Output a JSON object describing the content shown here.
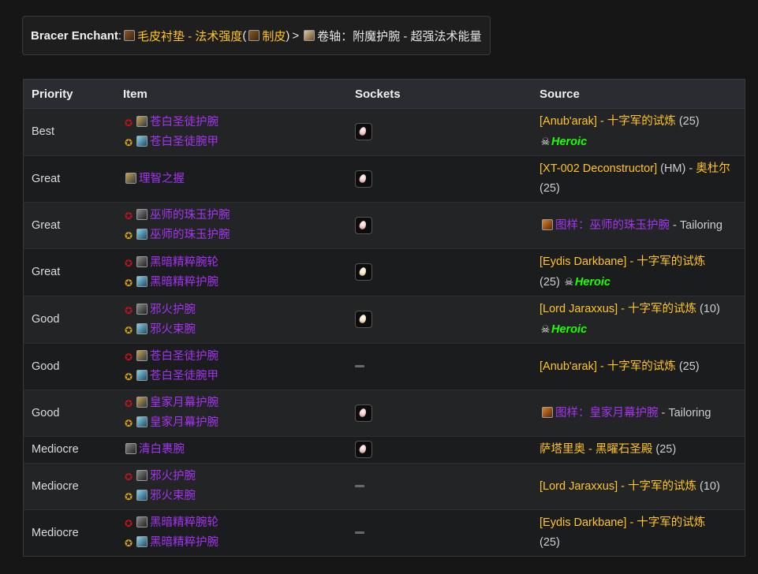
{
  "enchant": {
    "label": "Bracer Enchant",
    "colon": ":",
    "item1": "毛皮衬垫 - 法术强度",
    "paren_open": "(",
    "profession": "制皮",
    "paren_close": ")",
    "arrow": ">",
    "item2": "卷轴：附魔护腕 - 超强法术能量"
  },
  "table": {
    "headers": {
      "priority": "Priority",
      "item": "Item",
      "sockets": "Sockets",
      "source": "Source"
    },
    "rows": [
      {
        "priority": "Best",
        "horde_item": "苍白圣徒护腕",
        "alliance_item": "苍白圣徒腕甲",
        "socket": "gem",
        "src_a": "[Anub'arak] - 十字军的试炼",
        "src_b": " (25)",
        "heroic": "Heroic"
      },
      {
        "priority": "Great",
        "item": "理智之握",
        "socket": "gem",
        "src_a": "[XT-002 Deconstructor]",
        "src_b": " (HM) - ",
        "src_c": "奥杜尔",
        "src_d": " (25)"
      },
      {
        "priority": "Great",
        "horde_item": "巫师的珠玉护腕",
        "alliance_item": "巫师的珠玉护腕",
        "socket": "gem",
        "pattern": "图样：巫师的珠玉护腕",
        "pattern_suffix": " - Tailoring"
      },
      {
        "priority": "Great",
        "horde_item": "黑暗精粹腕轮",
        "alliance_item": "黑暗精粹护腕",
        "socket": "gem-yellow",
        "src_a": "[Eydis Darkbane] - 十字军的试炼",
        "src_b": " (25) ",
        "heroic": "Heroic"
      },
      {
        "priority": "Good",
        "horde_item": "邪火护腕",
        "alliance_item": "邪火束腕",
        "socket": "gem-yellow",
        "src_a": "[Lord Jaraxxus] - 十字军的试炼",
        "src_b": " (10)",
        "heroic": "Heroic"
      },
      {
        "priority": "Good",
        "horde_item": "苍白圣徒护腕",
        "alliance_item": "苍白圣徒腕甲",
        "socket": "none",
        "src_a": "[Anub'arak] - 十字军的试炼",
        "src_b": " (25)"
      },
      {
        "priority": "Good",
        "horde_item": "皇家月幕护腕",
        "alliance_item": "皇家月幕护腕",
        "socket": "gem",
        "pattern": "图样：皇家月幕护腕",
        "pattern_suffix": " - Tailoring"
      },
      {
        "priority": "Mediocre",
        "item": "清白裹腕",
        "socket": "gem",
        "src_a": "萨塔里奥 - 黑曜石圣殿",
        "src_b": " (25)"
      },
      {
        "priority": "Mediocre",
        "horde_item": "邪火护腕",
        "alliance_item": "邪火束腕",
        "socket": "none",
        "src_a": "[Lord Jaraxxus] - 十字军的试炼",
        "src_b": " (10)"
      },
      {
        "priority": "Mediocre",
        "horde_item": "黑暗精粹腕轮",
        "alliance_item": "黑暗精粹护腕",
        "socket": "none",
        "src_a": "[Eydis Darkbane] - 十字军的试炼",
        "src_b": " (25)"
      }
    ]
  },
  "icons": {
    "horde": "horde-emblem-icon",
    "alliance": "alliance-emblem-icon",
    "skull": "heroic-skull-icon",
    "socket": "prismatic-gem-socket-icon"
  },
  "colors": {
    "epic": "#a335ee",
    "link_gold": "#ffc526",
    "heroic": "#1eff00",
    "bg": "#161616"
  }
}
